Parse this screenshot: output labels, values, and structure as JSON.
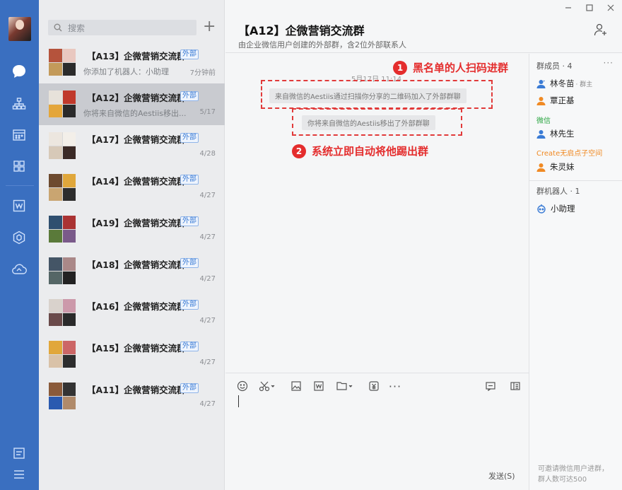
{
  "search": {
    "placeholder": "搜索"
  },
  "conversations": [
    {
      "name": "【A13】企微营销交流群",
      "tag": "外部",
      "preview": "你添加了机器人：小助理",
      "time": "7分钟前"
    },
    {
      "name": "【A12】企微营销交流群",
      "tag": "外部",
      "preview": "你将来自微信的Aestiis移出...",
      "time": "5/17"
    },
    {
      "name": "【A17】企微营销交流群",
      "tag": "外部",
      "preview": "",
      "time": "4/28"
    },
    {
      "name": "【A14】企微营销交流群",
      "tag": "外部",
      "preview": "",
      "time": "4/27"
    },
    {
      "name": "【A19】企微营销交流群",
      "tag": "外部",
      "preview": "",
      "time": "4/27"
    },
    {
      "name": "【A18】企微营销交流群",
      "tag": "外部",
      "preview": "",
      "time": "4/27"
    },
    {
      "name": "【A16】企微营销交流群",
      "tag": "外部",
      "preview": "",
      "time": "4/27"
    },
    {
      "name": "【A15】企微营销交流群",
      "tag": "外部",
      "preview": "",
      "time": "4/27"
    },
    {
      "name": "【A11】企微营销交流群",
      "tag": "外部",
      "preview": "",
      "time": "4/27"
    }
  ],
  "chat": {
    "title": "【A12】企微营销交流群",
    "subtitle": "由企业微信用户创建的外部群，含2位外部联系人",
    "date": "5月17日 11:14",
    "messages": [
      "来自微信的Aestiis通过扫描你分享的二维码加入了外部群聊",
      "你将来自微信的Aestiis移出了外部群聊"
    ],
    "send_label": "发送(S)"
  },
  "annotations": [
    {
      "num": "1",
      "text": "黑名单的人扫码进群"
    },
    {
      "num": "2",
      "text": "系统立即自动将他踢出群"
    }
  ],
  "members": {
    "title": "群成员 · 4",
    "owner": {
      "name": "林冬苗",
      "role": "· 群主"
    },
    "member2": "覃正基",
    "group_wechat": "微信",
    "member3": "林先生",
    "group_create": "Create无启点子空间",
    "member4": "朱灵妹",
    "robots_title": "群机器人 · 1",
    "robot": "小助理",
    "footer_line1": "可邀请微信用户进群，",
    "footer_line2": "群人数可达500"
  },
  "colors": {
    "rail": "#3a6fc0",
    "accent": "#3a7bd5",
    "annotation": "#e42d2d",
    "wechat_group": "#2aa541",
    "create_group": "#f08a24"
  },
  "icons": [
    "chat-icon",
    "org-icon",
    "calendar-icon",
    "apps-icon",
    "doc-icon",
    "workbench-icon",
    "cloud-icon",
    "note-icon",
    "menu-icon"
  ]
}
